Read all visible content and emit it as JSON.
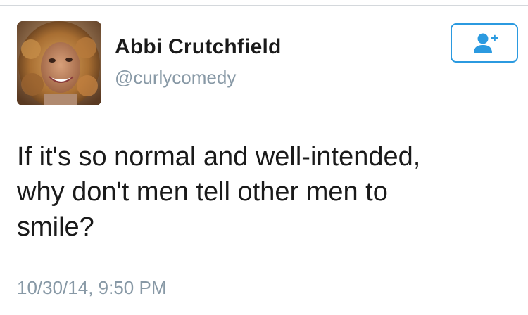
{
  "tweet": {
    "author": {
      "display_name": "Abbi Crutchfield",
      "handle": "@curlycomedy",
      "avatar_icon": "profile-photo"
    },
    "follow_button": {
      "icon": "add-user-icon",
      "accent_color": "#2b9ae0"
    },
    "text": "If it's so normal and well-intended,\nwhy don't men tell other men to\nsmile?",
    "timestamp": "10/30/14, 9:50 PM"
  },
  "colors": {
    "primary_text": "#1a1a1a",
    "secondary_text": "#8899a6",
    "accent": "#2b9ae0",
    "divider": "#d4d8dc"
  }
}
